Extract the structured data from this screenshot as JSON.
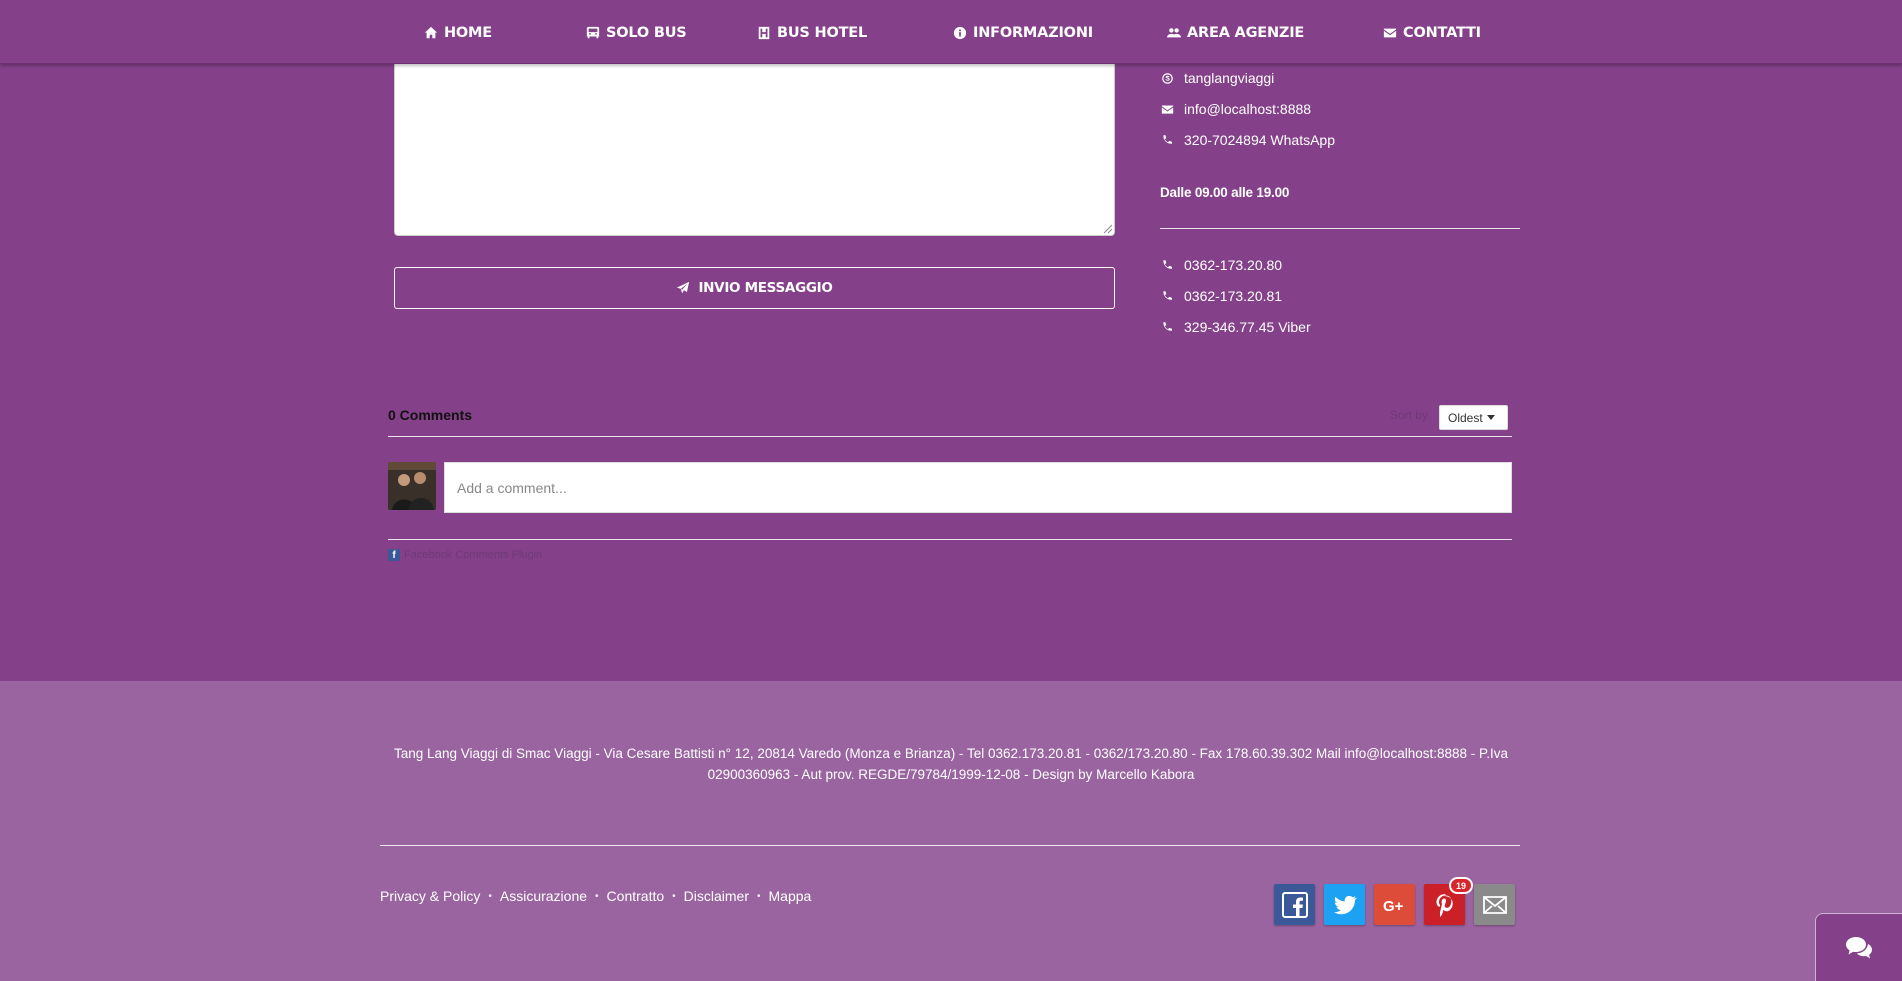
{
  "nav": {
    "items": [
      {
        "label": "HOME",
        "icon": "home-icon"
      },
      {
        "label": "SOLO BUS",
        "icon": "bus-icon"
      },
      {
        "label": "BUS HOTEL",
        "icon": "hotel-icon"
      },
      {
        "label": "INFORMAZIONI",
        "icon": "info-icon"
      },
      {
        "label": "AREA AGENZIE",
        "icon": "users-icon"
      },
      {
        "label": "CONTATTI",
        "icon": "envelope-icon"
      }
    ]
  },
  "form": {
    "message_value": "",
    "send_label": "INVIO MESSAGGIO"
  },
  "contacts": {
    "skype": "tanglangviaggi",
    "email": "info@localhost:8888",
    "whatsapp": "320-7024894 WhatsApp",
    "hours": "Dalle 09.00 alle 19.00",
    "phone1": "0362-173.20.80",
    "phone2": "0362-173.20.81",
    "viber": "329-346.77.45 Viber"
  },
  "comments": {
    "count_label": "0 Comments",
    "sort_label": "Sort by",
    "sort_value": "Oldest",
    "input_placeholder": "Add a comment...",
    "plugin_label": "Facebook Comments Plugin"
  },
  "footer": {
    "info": "Tang Lang Viaggi di Smac Viaggi - Via Cesare Battisti n° 12, 20814 Varedo (Monza e Brianza) - Tel 0362.173.20.81 - 0362/173.20.80 - Fax 178.60.39.302 Mail info@localhost:8888 - P.Iva 02900360963 - Aut prov. REGDE/79784/1999-12-08 - Design by Marcello Kabora",
    "links": [
      "Privacy & Policy",
      "Assicurazione",
      "Contratto",
      "Disclaimer",
      "Mappa"
    ],
    "separator": "•",
    "social": [
      {
        "name": "facebook",
        "color": "#3b5998"
      },
      {
        "name": "twitter",
        "color": "#1da1f2"
      },
      {
        "name": "google-plus",
        "color": "#dd4b39"
      },
      {
        "name": "pinterest",
        "color": "#cb2027"
      },
      {
        "name": "email",
        "color": "#8a8a8a"
      }
    ],
    "pinterest_count": "19"
  },
  "colors": {
    "primary": "#844189",
    "footer": "#9a64a0"
  }
}
